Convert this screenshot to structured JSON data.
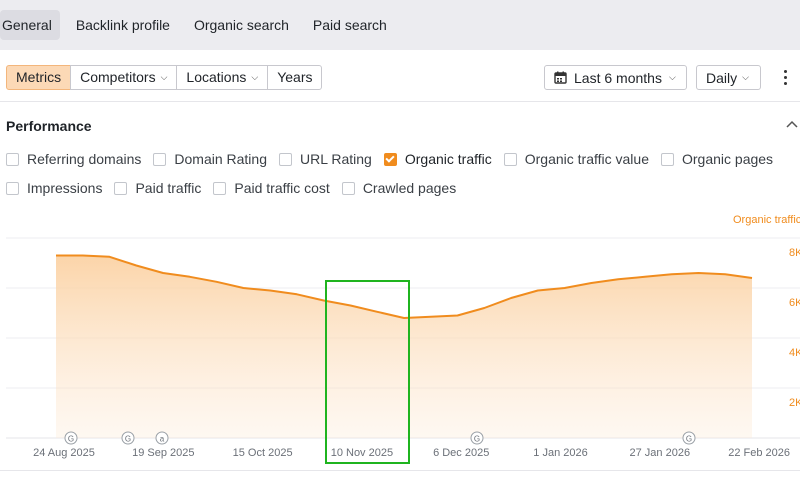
{
  "top_tabs": [
    {
      "label": "General",
      "active": true
    },
    {
      "label": "Backlink profile",
      "active": false
    },
    {
      "label": "Organic search",
      "active": false
    },
    {
      "label": "Paid search",
      "active": false
    }
  ],
  "toolbar": {
    "segments": [
      {
        "label": "Metrics",
        "active": true,
        "dropdown": false
      },
      {
        "label": "Competitors",
        "active": false,
        "dropdown": true
      },
      {
        "label": "Locations",
        "active": false,
        "dropdown": true
      },
      {
        "label": "Years",
        "active": false,
        "dropdown": false
      }
    ],
    "date_range": "Last 6 months",
    "granularity": "Daily"
  },
  "performance": {
    "title": "Performance",
    "metrics_row1": [
      {
        "label": "Referring domains",
        "checked": false
      },
      {
        "label": "Domain Rating",
        "checked": false
      },
      {
        "label": "URL Rating",
        "checked": false
      },
      {
        "label": "Organic traffic",
        "checked": true
      },
      {
        "label": "Organic traffic value",
        "checked": false
      },
      {
        "label": "Organic pages",
        "checked": false
      }
    ],
    "metrics_row2": [
      {
        "label": "Impressions",
        "checked": false
      },
      {
        "label": "Paid traffic",
        "checked": false
      },
      {
        "label": "Paid traffic cost",
        "checked": false
      },
      {
        "label": "Crawled pages",
        "checked": false
      }
    ]
  },
  "colors": {
    "accent": "#f08c1e",
    "area_fill": "#fbd2a4",
    "highlight": "#1fb41f"
  },
  "chart_data": {
    "type": "area",
    "series": [
      {
        "name": "Organic traffic",
        "x": [
          "2025-08-24",
          "2025-08-31",
          "2025-09-07",
          "2025-09-14",
          "2025-09-21",
          "2025-09-28",
          "2025-10-05",
          "2025-10-12",
          "2025-10-19",
          "2025-10-26",
          "2025-11-02",
          "2025-11-09",
          "2025-11-16",
          "2025-11-23",
          "2025-11-30",
          "2025-12-07",
          "2025-12-14",
          "2025-12-21",
          "2025-12-28",
          "2026-01-04",
          "2026-01-11",
          "2026-01-18",
          "2026-01-25",
          "2026-02-01",
          "2026-02-08",
          "2026-02-15",
          "2026-02-22"
        ],
        "values": [
          7300,
          7300,
          7250,
          6900,
          6600,
          6450,
          6250,
          6000,
          5900,
          5750,
          5500,
          5300,
          5050,
          4800,
          4850,
          4900,
          5200,
          5600,
          5900,
          6000,
          6200,
          6350,
          6450,
          6550,
          6600,
          6550,
          6400
        ]
      }
    ],
    "x_tick_labels": [
      "24 Aug 2025",
      "19 Sep 2025",
      "15 Oct 2025",
      "10 Nov 2025",
      "6 Dec 2025",
      "1 Jan 2026",
      "27 Jan 2026",
      "22 Feb 2026"
    ],
    "y_ticks": [
      "8K",
      "6K",
      "4K",
      "2K"
    ],
    "y_tick_values": [
      8000,
      6000,
      4000,
      2000
    ],
    "y_axis_title": "Organic traffic",
    "ylim": [
      0,
      8000
    ],
    "grid": true,
    "event_markers": [
      "G",
      "G",
      "a",
      "G",
      "G"
    ]
  }
}
